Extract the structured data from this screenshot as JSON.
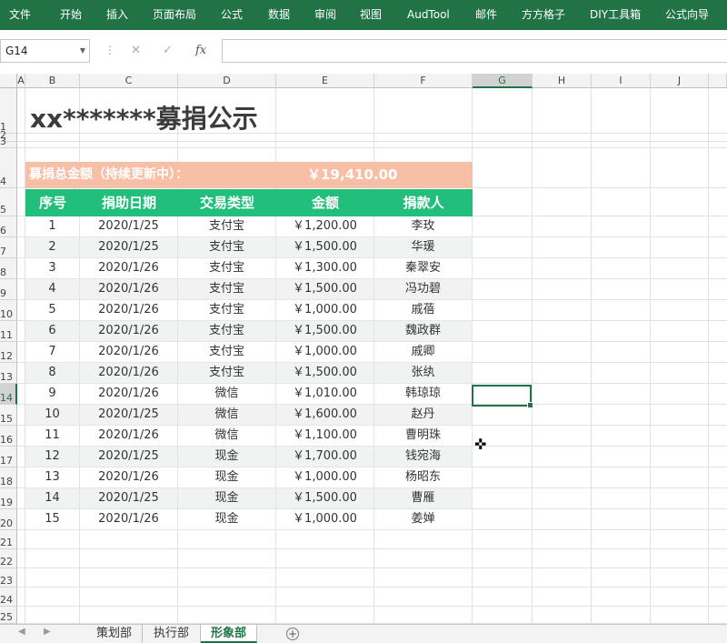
{
  "ribbon": {
    "tabs": [
      "文件",
      "开始",
      "插入",
      "页面布局",
      "公式",
      "数据",
      "审阅",
      "视图",
      "AudTool",
      "邮件",
      "方方格子",
      "DIY工具箱",
      "公式向导"
    ]
  },
  "formula_bar": {
    "name_box": "G14",
    "cancel_icon": "✕",
    "enter_icon": "✓",
    "fx_label": "fx",
    "content": ""
  },
  "columns": [
    "A",
    "B",
    "C",
    "D",
    "E",
    "F",
    "G",
    "H",
    "I",
    "J"
  ],
  "rows": [
    "1",
    "2",
    "3",
    "4",
    "5",
    "6",
    "7",
    "8",
    "9",
    "10",
    "11",
    "12",
    "13",
    "14",
    "15",
    "16",
    "17",
    "18",
    "19",
    "20",
    "21",
    "22",
    "23",
    "24",
    "25"
  ],
  "selected_cell": {
    "column": "G",
    "row": "14"
  },
  "sheet": {
    "title": "xx*******募捐公示",
    "total_label": "募捐总金额（持续更新中）：",
    "total_value": "￥19,410.00",
    "headers": [
      "序号",
      "捐助日期",
      "交易类型",
      "金额",
      "捐款人"
    ],
    "records": [
      [
        "1",
        "2020/1/25",
        "支付宝",
        "￥1,200.00",
        "李玫"
      ],
      [
        "2",
        "2020/1/25",
        "支付宝",
        "￥1,500.00",
        "华瑗"
      ],
      [
        "3",
        "2020/1/26",
        "支付宝",
        "￥1,300.00",
        "秦翠安"
      ],
      [
        "4",
        "2020/1/26",
        "支付宝",
        "￥1,500.00",
        "冯功碧"
      ],
      [
        "5",
        "2020/1/26",
        "支付宝",
        "￥1,000.00",
        "戚蓓"
      ],
      [
        "6",
        "2020/1/26",
        "支付宝",
        "￥1,500.00",
        "魏政群"
      ],
      [
        "7",
        "2020/1/26",
        "支付宝",
        "￥1,000.00",
        "戚卿"
      ],
      [
        "8",
        "2020/1/26",
        "支付宝",
        "￥1,500.00",
        "张纨"
      ],
      [
        "9",
        "2020/1/26",
        "微信",
        "￥1,010.00",
        "韩琼琼"
      ],
      [
        "10",
        "2020/1/25",
        "微信",
        "￥1,600.00",
        "赵丹"
      ],
      [
        "11",
        "2020/1/26",
        "微信",
        "￥1,100.00",
        "曹明珠"
      ],
      [
        "12",
        "2020/1/25",
        "现金",
        "￥1,700.00",
        "钱宛海"
      ],
      [
        "13",
        "2020/1/26",
        "现金",
        "￥1,000.00",
        "杨昭东"
      ],
      [
        "14",
        "2020/1/25",
        "现金",
        "￥1,500.00",
        "曹雁"
      ],
      [
        "15",
        "2020/1/26",
        "现金",
        "￥1,000.00",
        "姜婵"
      ]
    ]
  },
  "sheet_tabs": [
    "策划部",
    "执行部",
    "形象部"
  ],
  "active_sheet": "形象部",
  "colors": {
    "ribbon": "#217346",
    "total_bar": "#f8bfa7",
    "header_bar": "#21be7c",
    "alt_row": "#f1f3f2"
  }
}
